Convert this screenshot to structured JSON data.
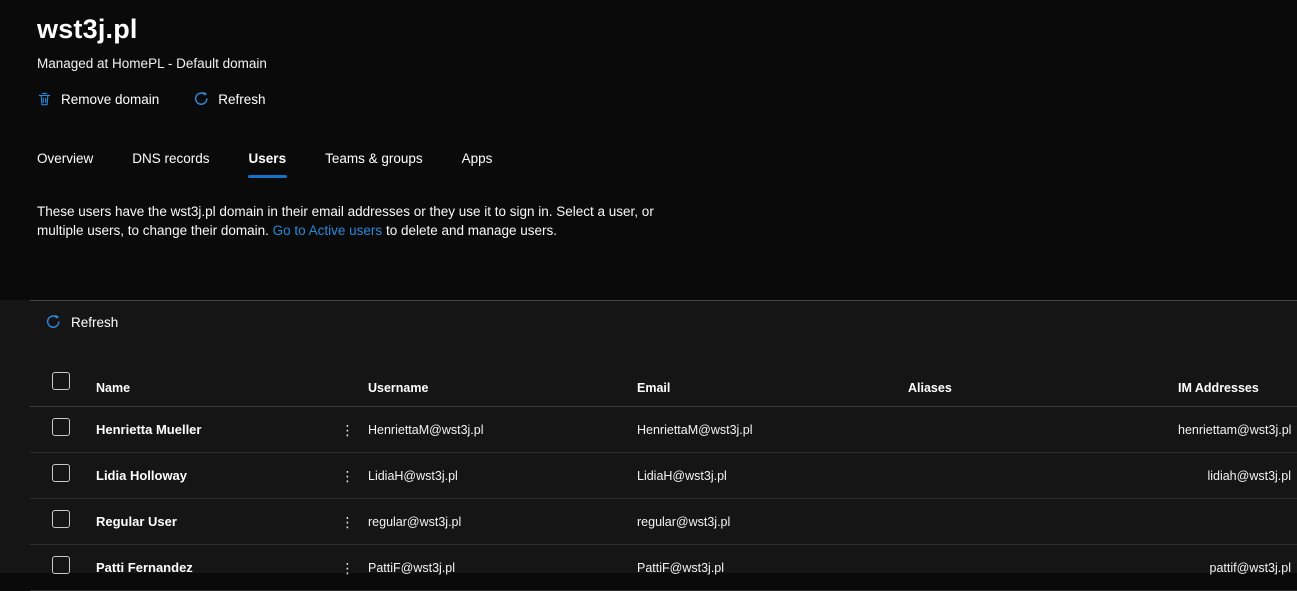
{
  "header": {
    "title": "wst3j.pl",
    "subtitle": "Managed at HomePL - Default domain"
  },
  "command_bar": {
    "remove_domain_label": "Remove domain",
    "refresh_label": "Refresh"
  },
  "tabs": {
    "items": [
      "Overview",
      "DNS records",
      "Users",
      "Teams & groups",
      "Apps"
    ],
    "active_tab": "Users"
  },
  "description": {
    "part1": "These users have the wst3j.pl domain in their email addresses or they use it to sign in. Select a user, or multiple users, to change their domain. ",
    "link_text": "Go to Active users",
    "part2": " to delete and manage users."
  },
  "toolbar": {
    "refresh_label": "Refresh"
  },
  "table": {
    "columns": [
      "Name",
      "Username",
      "Email",
      "Aliases",
      "IM Addresses"
    ],
    "rows": [
      {
        "name": "Henrietta Mueller",
        "username": "HenriettaM@wst3j.pl",
        "email": "HenriettaM@wst3j.pl",
        "aliases": "",
        "im": "henriettam@wst3j.pl"
      },
      {
        "name": "Lidia Holloway",
        "username": "LidiaH@wst3j.pl",
        "email": "LidiaH@wst3j.pl",
        "aliases": "",
        "im": "lidiah@wst3j.pl"
      },
      {
        "name": "Regular User",
        "username": "regular@wst3j.pl",
        "email": "regular@wst3j.pl",
        "aliases": "",
        "im": ""
      },
      {
        "name": "Patti Fernandez",
        "username": "PattiF@wst3j.pl",
        "email": "PattiF@wst3j.pl",
        "aliases": "",
        "im": "pattif@wst3j.pl"
      }
    ]
  },
  "colors": {
    "accent": "#2b88d8",
    "tab_underline": "#1373cc",
    "page_bg": "#0a0a0a",
    "panel_bg": "#151515"
  }
}
